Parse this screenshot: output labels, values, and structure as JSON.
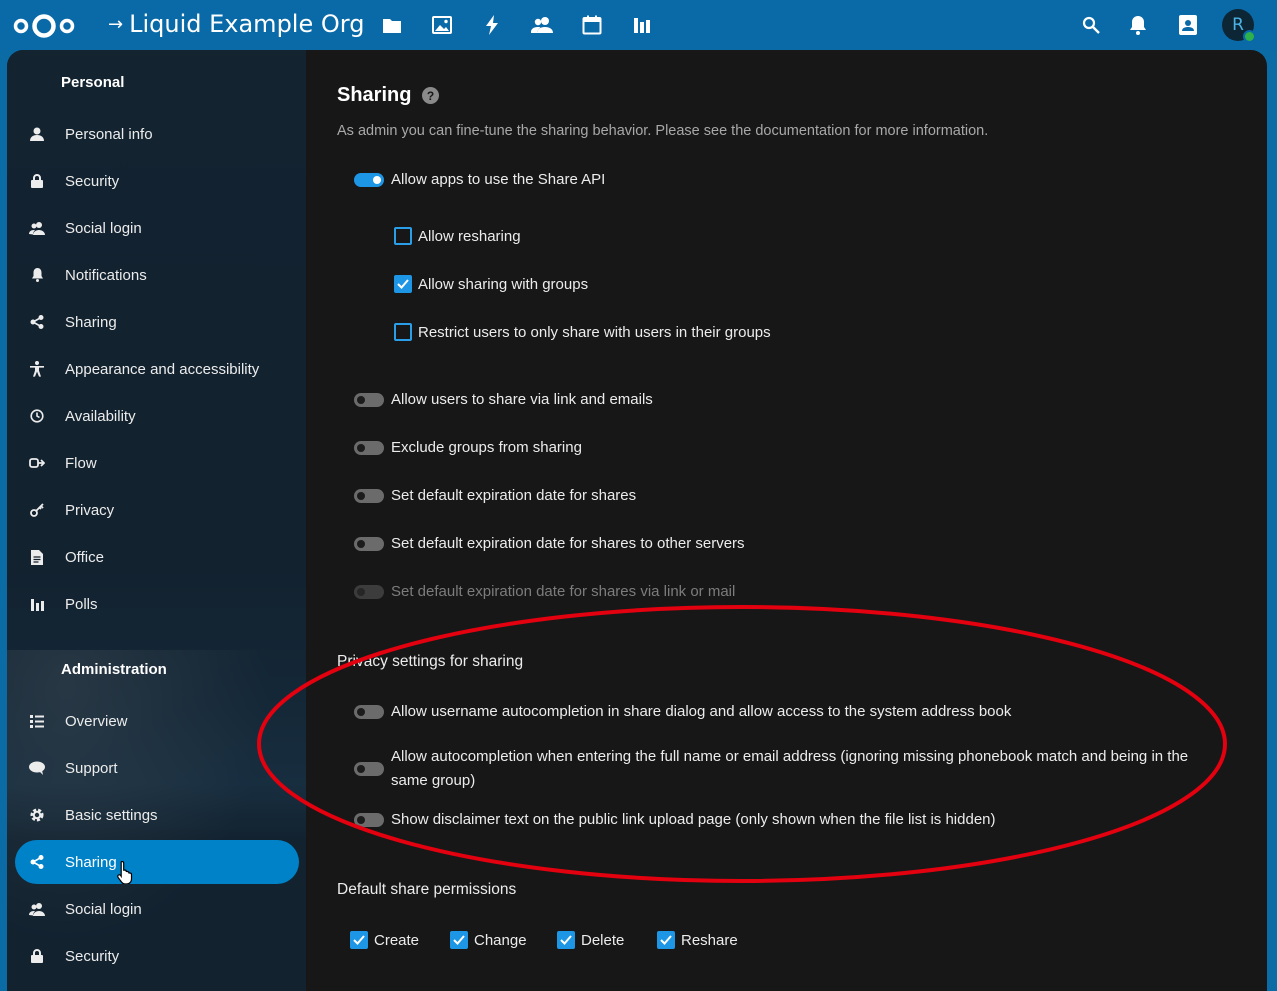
{
  "header": {
    "org_name": "Liquid Example Org",
    "apps": [
      "files-icon",
      "photos-icon",
      "activity-icon",
      "contacts-icon",
      "calendar-icon",
      "polls-icon"
    ],
    "right": [
      "search-icon",
      "bell-icon",
      "contacts-menu-icon"
    ],
    "avatar_initial": "R",
    "status_color": "#2eb14a"
  },
  "sidebar": {
    "personal_caption": "Personal",
    "personal_items": [
      {
        "label": "Personal info",
        "icon": "person-icon"
      },
      {
        "label": "Security",
        "icon": "lock-icon"
      },
      {
        "label": "Social login",
        "icon": "group-icon"
      },
      {
        "label": "Notifications",
        "icon": "bell-icon"
      },
      {
        "label": "Sharing",
        "icon": "share-icon"
      },
      {
        "label": "Appearance and accessibility",
        "icon": "accessibility-icon"
      },
      {
        "label": "Availability",
        "icon": "clock-icon"
      },
      {
        "label": "Flow",
        "icon": "flow-icon"
      },
      {
        "label": "Privacy",
        "icon": "key-icon"
      },
      {
        "label": "Office",
        "icon": "document-icon"
      },
      {
        "label": "Polls",
        "icon": "polls-icon"
      }
    ],
    "admin_caption": "Administration",
    "admin_items": [
      {
        "label": "Overview",
        "icon": "list-icon"
      },
      {
        "label": "Support",
        "icon": "chat-icon"
      },
      {
        "label": "Basic settings",
        "icon": "gear-icon"
      },
      {
        "label": "Sharing",
        "icon": "share-icon",
        "active": true
      },
      {
        "label": "Social login",
        "icon": "group-icon"
      },
      {
        "label": "Security",
        "icon": "lock-icon"
      }
    ]
  },
  "main": {
    "title": "Sharing",
    "help": "?",
    "description": "As admin you can fine-tune the sharing behavior. Please see the documentation for more information.",
    "share_api": {
      "label": "Allow apps to use the Share API",
      "on": true
    },
    "sub_options": [
      {
        "label": "Allow resharing",
        "checked": false
      },
      {
        "label": "Allow sharing with groups",
        "checked": true
      },
      {
        "label": "Restrict users to only share with users in their groups",
        "checked": false
      }
    ],
    "toggles": [
      {
        "label": "Allow users to share via link and emails",
        "on": false
      },
      {
        "label": "Exclude groups from sharing",
        "on": false
      },
      {
        "label": "Set default expiration date for shares",
        "on": false
      },
      {
        "label": "Set default expiration date for shares to other servers",
        "on": false
      },
      {
        "label": "Set default expiration date for shares via link or mail",
        "on": false,
        "disabled": true
      }
    ],
    "privacy_heading": "Privacy settings for sharing",
    "privacy_toggles": [
      {
        "label": "Allow username autocompletion in share dialog and allow access to the system address book"
      },
      {
        "label_line1": "Allow autocompletion when entering the full name or email address (ignoring missing phonebook match and being in the",
        "label_line2": "same group)"
      },
      {
        "label": "Show disclaimer text on the public link upload page (only shown when the file list is hidden)"
      }
    ],
    "permissions_heading": "Default share permissions",
    "permissions": [
      {
        "label": "Create",
        "checked": true
      },
      {
        "label": "Change",
        "checked": true
      },
      {
        "label": "Delete",
        "checked": true
      },
      {
        "label": "Reshare",
        "checked": true
      }
    ]
  },
  "annotation_color": "#e3000f"
}
